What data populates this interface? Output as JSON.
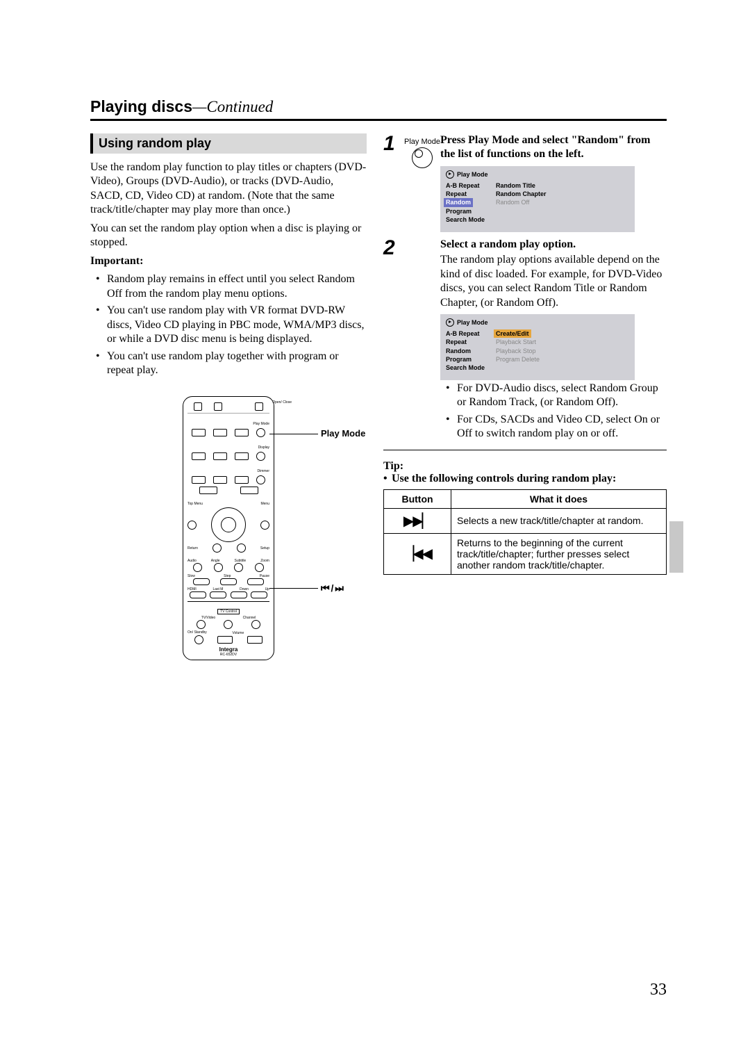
{
  "chapter": {
    "title": "Playing discs",
    "cont": "—Continued"
  },
  "section_title": "Using random play",
  "intro_para1": "Use the random play function to play titles or chapters (DVD-Video), Groups (DVD-Audio), or tracks (DVD-Audio, SACD, CD, Video CD) at random. (Note that the same track/title/chapter may play more than once.)",
  "intro_para2": "You can set the random play option when a disc is playing or stopped.",
  "important_label": "Important:",
  "important_items": [
    "Random play remains in effect until you select Random Off from the random play menu options.",
    "You can't use random play with VR format DVD-RW discs, Video CD playing in PBC mode, WMA/MP3 discs, or while a DVD disc menu is being displayed.",
    "You can't use random play together with program or repeat play."
  ],
  "remote": {
    "callout_playmode": "Play Mode",
    "callout_nav": "⏮ / ⏭",
    "brand": "Integra",
    "model": "RC-652DV",
    "labels": {
      "open_close": "Open/\nClose",
      "play_mode_tiny": "Play Mode",
      "display": "Display",
      "dimmer": "Dimmer",
      "top_menu": "Top Menu",
      "menu": "Menu",
      "return": "Return",
      "setup": "Setup",
      "audio": "Audio",
      "angle": "Angle",
      "subtitle": "Subtitle",
      "zoom": "Zoom",
      "slow": "Slow",
      "step": "Step",
      "pause": "Pause",
      "hdmi": "HDMI",
      "last_m": "Last M",
      "down": "Down",
      "up": "Up",
      "tv_control": "TV Control",
      "tv_video": "TV/Video",
      "channel": "Channel",
      "on_standby": "On/\nStandby",
      "volume": "Volume"
    }
  },
  "steps": [
    {
      "num": "1",
      "icon_label": "Play Mode",
      "heading": "Press Play Mode and select \"Random\" from the list of functions on the left.",
      "menu": {
        "header": "Play Mode",
        "left": [
          "A-B Repeat",
          "Repeat",
          "Random",
          "Program",
          "Search Mode"
        ],
        "left_selected_index": 2,
        "right": [
          "Random Title",
          "Random Chapter",
          "Random Off"
        ],
        "right_selected_index": -1,
        "right_dim_from": 2
      }
    },
    {
      "num": "2",
      "heading": "Select a random play option.",
      "body": "The random play options available depend on the kind of disc loaded. For example, for DVD-Video discs, you can select Random Title or Random Chapter, (or Random Off).",
      "menu": {
        "header": "Play Mode",
        "left": [
          "A-B Repeat",
          "Repeat",
          "Random",
          "Program",
          "Search Mode"
        ],
        "left_selected_index": -1,
        "right": [
          "Create/Edit",
          "Playback Start",
          "Playback Stop",
          "Program Delete"
        ],
        "right_selected_index": 0,
        "right_dim_from": 1
      },
      "sub_bullets": [
        "For DVD-Audio discs, select Random Group or Random Track, (or Random Off).",
        "For CDs, SACDs and Video CD, select On or Off to switch random play on or off."
      ]
    }
  ],
  "tip": {
    "label": "Tip:",
    "line": "Use the following controls during random play:",
    "table": {
      "headers": [
        "Button",
        "What it does"
      ],
      "rows": [
        {
          "icon": "next",
          "desc": "Selects a new track/title/chapter at random."
        },
        {
          "icon": "prev",
          "desc": "Returns to the beginning of the current track/title/chapter; further presses select another random track/title/chapter."
        }
      ]
    }
  },
  "icon_glyphs": {
    "next": "▶▶▏",
    "prev": "▕◀◀"
  },
  "page_number": "33"
}
